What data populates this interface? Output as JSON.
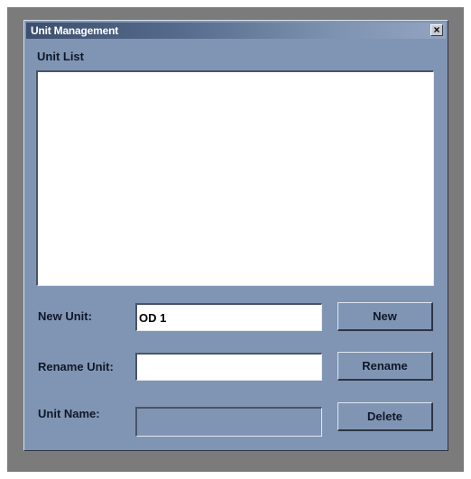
{
  "window": {
    "title": "Unit Management",
    "close_glyph": "×"
  },
  "unit_list": {
    "label": "Unit List",
    "items": []
  },
  "new_unit": {
    "label": "New Unit:",
    "value": "OD 1",
    "button_label": "New"
  },
  "rename_unit": {
    "label": "Rename Unit:",
    "value": "",
    "button_label": "Rename"
  },
  "unit_name": {
    "label": "Unit Name:",
    "value": "",
    "button_label": "Delete"
  },
  "colors": {
    "dialog_background": "#8095b4",
    "titlebar_dark": "#3c4f6e",
    "titlebar_light": "#92a4c0",
    "backdrop": "#7b7b7b"
  },
  "icons": {
    "close": "close-icon"
  }
}
